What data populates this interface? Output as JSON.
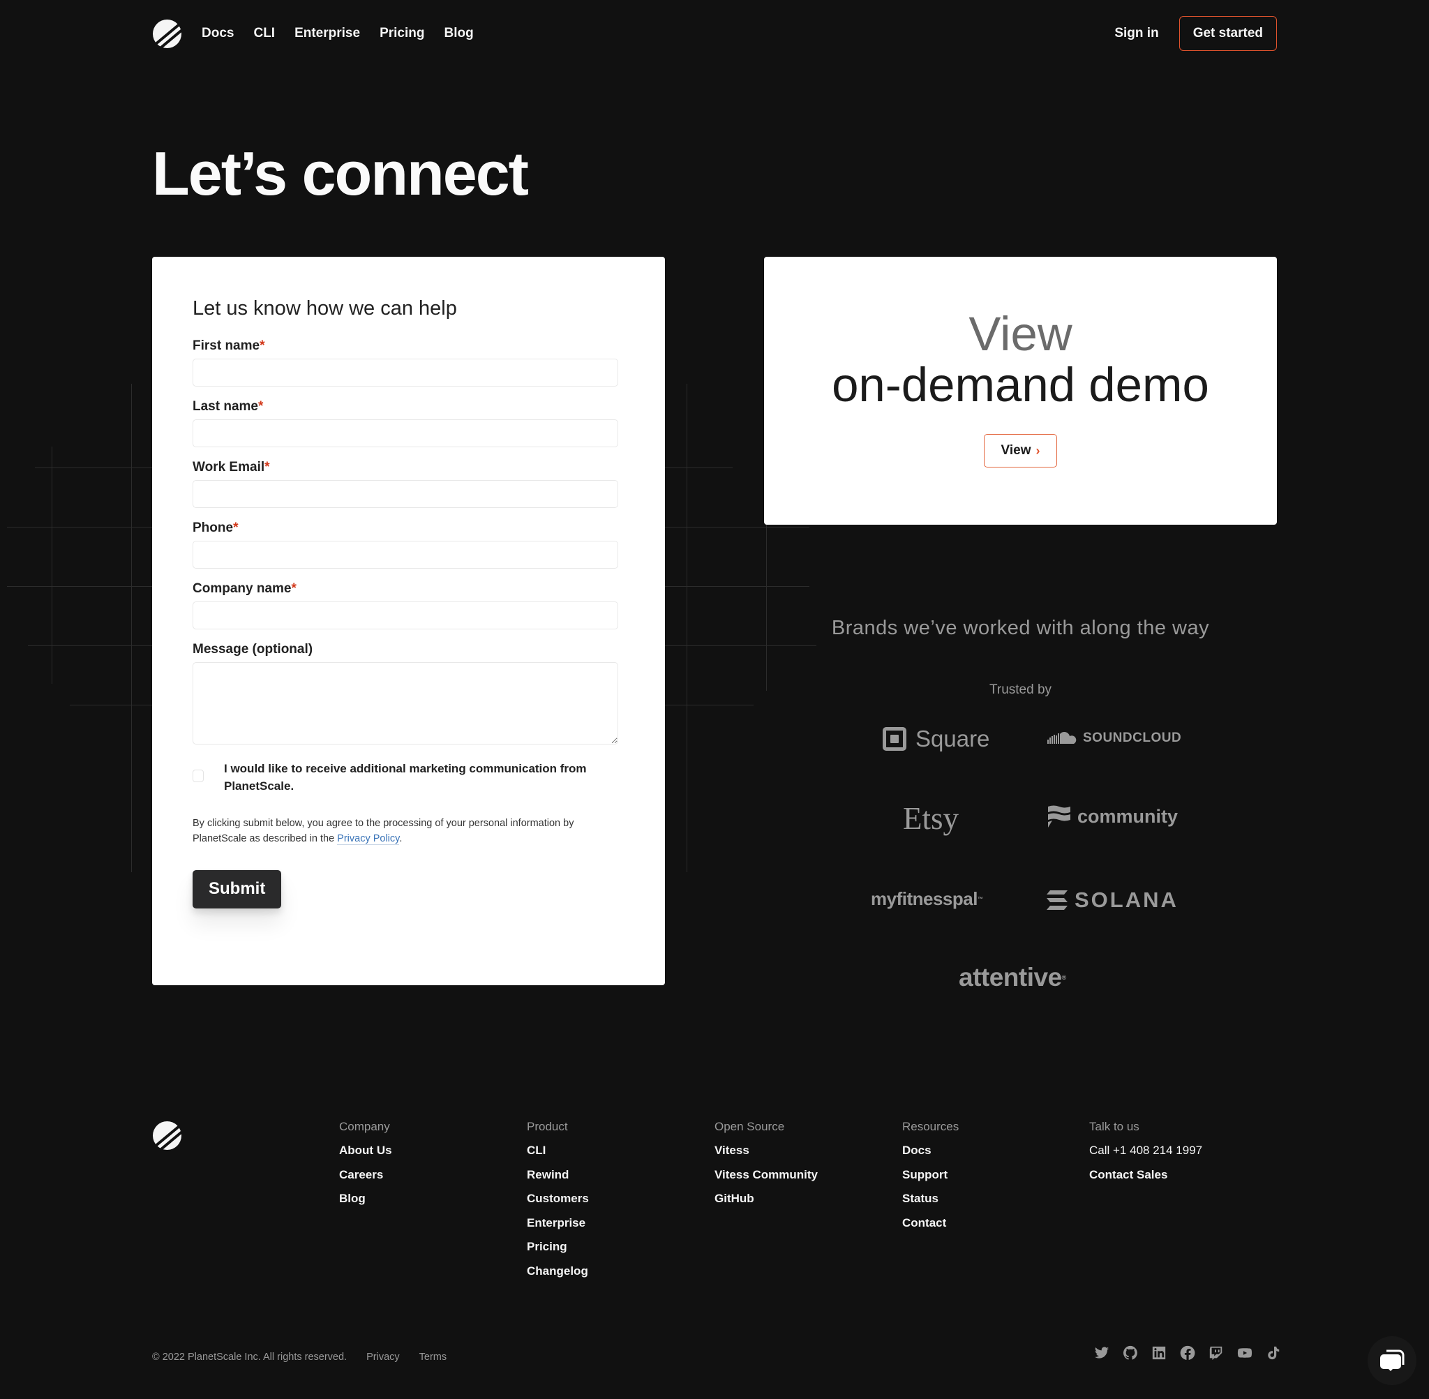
{
  "header": {
    "logo": "planetscale-logo",
    "nav": [
      "Docs",
      "CLI",
      "Enterprise",
      "Pricing",
      "Blog"
    ],
    "sign_in": "Sign in",
    "get_started": "Get started"
  },
  "hero": {
    "title": "Let’s connect"
  },
  "form": {
    "title": "Let us know how we can help",
    "fields": [
      {
        "label": "First name",
        "required": "*",
        "value": ""
      },
      {
        "label": "Last name",
        "required": "*",
        "value": ""
      },
      {
        "label": "Work Email",
        "required": "*",
        "value": ""
      },
      {
        "label": "Phone",
        "required": "*",
        "value": ""
      },
      {
        "label": "Company name",
        "required": "*",
        "value": ""
      }
    ],
    "message_label": "Message (optional)",
    "message_value": "",
    "marketing_checkbox_label": "I would like to receive additional marketing communication from PlanetScale.",
    "marketing_checked": false,
    "consent_prefix": "By clicking submit below, you agree to the processing of your personal information by PlanetScale as described in the ",
    "consent_link": "Privacy Policy",
    "consent_suffix": ".",
    "submit": "Submit"
  },
  "demo": {
    "line1": "View",
    "line2": "on-demand demo",
    "button": "View"
  },
  "brands": {
    "title": "Brands we’ve worked with along the way",
    "trusted_by": "Trusted by",
    "logos": [
      "Square",
      "SOUNDCLOUD",
      "Etsy",
      "community",
      "myfitnesspal",
      "SOLANA",
      "attentive"
    ]
  },
  "footer": {
    "columns": [
      {
        "heading": "Company",
        "links": [
          "About Us",
          "Careers",
          "Blog"
        ]
      },
      {
        "heading": "Product",
        "links": [
          "CLI",
          "Rewind",
          "Customers",
          "Enterprise",
          "Pricing",
          "Changelog"
        ]
      },
      {
        "heading": "Open Source",
        "links": [
          "Vitess",
          "Vitess Community",
          "GitHub"
        ]
      },
      {
        "heading": "Resources",
        "links": [
          "Docs",
          "Support",
          "Status",
          "Contact"
        ]
      },
      {
        "heading": "Talk to us",
        "phone": "Call +1 408 214 1997",
        "links": [
          "Contact Sales"
        ]
      }
    ],
    "copyright": "© 2022 PlanetScale Inc. All rights reserved.",
    "privacy": "Privacy",
    "terms": "Terms",
    "socials": [
      "twitter",
      "github",
      "linkedin",
      "facebook",
      "twitch",
      "youtube",
      "tiktok"
    ]
  },
  "colors": {
    "background": "#111111",
    "accent": "#e0532d",
    "required": "#d2381a",
    "link": "#3a74b8",
    "muted": "#9a9a9a"
  }
}
